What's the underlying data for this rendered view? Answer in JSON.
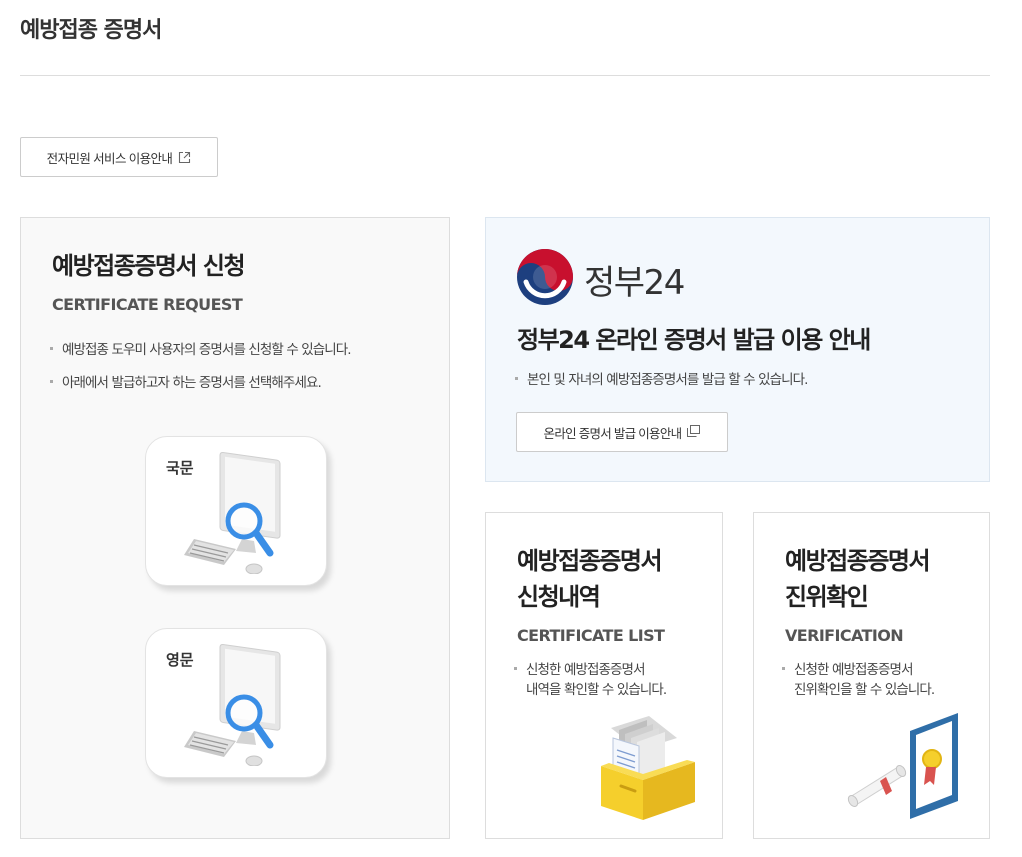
{
  "page": {
    "title": "예방접종 증명서"
  },
  "guide_button": {
    "label": "전자민원 서비스 이용안내",
    "icon": "external-link-icon"
  },
  "apply_card": {
    "title": "예방접종증명서 신청",
    "subtitle": "CERTIFICATE REQUEST",
    "bullets": [
      "예방접종 도우미 사용자의 증명서를 신청할 수 있습니다.",
      "아래에서 발급하고자 하는 증명서를 선택해주세요."
    ],
    "options": [
      {
        "label": "국문",
        "icon": "computer-magnifier-icon"
      },
      {
        "label": "영문",
        "icon": "computer-magnifier-icon"
      }
    ]
  },
  "gov_card": {
    "logo_text": "정부24",
    "title": "정부24 온라인 증명서 발급 이용 안내",
    "bullet": "본인 및 자녀의 예방접종증명서를 발급 할 수 있습니다.",
    "button_label": "온라인 증명서 발급 이용안내",
    "button_icon": "popup-window-icon"
  },
  "list_card": {
    "title_line1": "예방접종증명서",
    "title_line2": "신청내역",
    "subtitle": "CERTIFICATE LIST",
    "bullet_line1": "신청한 예방접종증명서",
    "bullet_line2": "내역을 확인할 수 있습니다.",
    "icon": "document-box-icon"
  },
  "verify_card": {
    "title_line1": "예방접종증명서",
    "title_line2": "진위확인",
    "subtitle": "VERIFICATION",
    "bullet_line1": "신청한 예방접종증명서",
    "bullet_line2": "진위확인을 할 수 있습니다.",
    "icon": "certificate-award-icon"
  },
  "colors": {
    "gov_blue": "#1d3f7f",
    "gov_red": "#c8102e",
    "magnifier_blue": "#3a8ee6",
    "box_yellow": "#f5cf2c",
    "frame_blue": "#2f6ea8"
  }
}
